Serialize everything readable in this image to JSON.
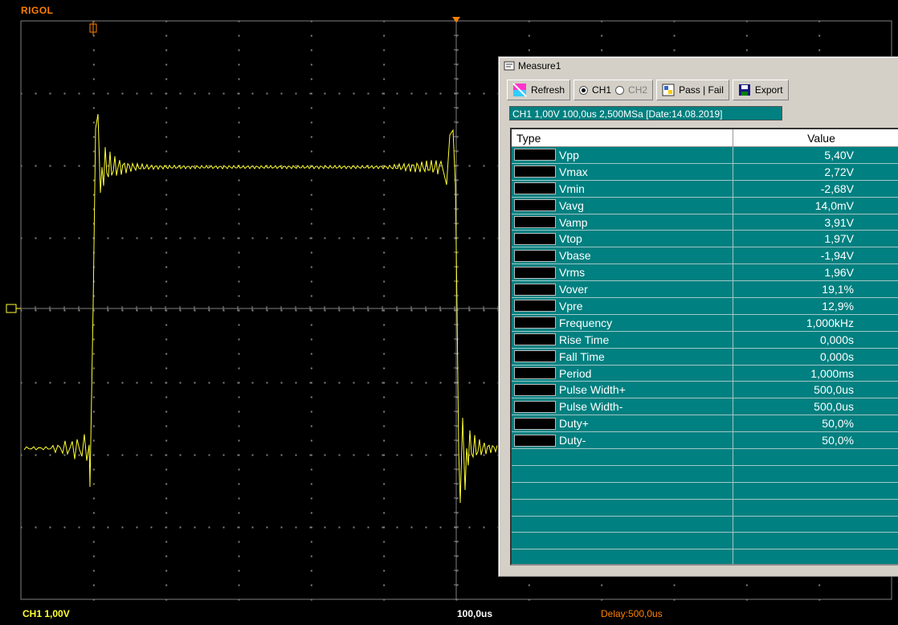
{
  "brand": "RIGOL",
  "status": {
    "channel": "CH1  1,00V",
    "timebase": "100,0us",
    "delay": "Delay:500,0us"
  },
  "window": {
    "title": "Measure1",
    "toolbar": {
      "refresh": "Refresh",
      "ch1": "CH1",
      "ch2": "CH2",
      "passfail": "Pass | Fail",
      "export": "Export"
    },
    "info": "CH1 1,00V  100,0us 2,500MSa  [Date:14.08.2019]",
    "table": {
      "col_type": "Type",
      "col_value": "Value",
      "rows": [
        {
          "type": "Vpp",
          "value": "5,40V"
        },
        {
          "type": "Vmax",
          "value": "2,72V"
        },
        {
          "type": "Vmin",
          "value": "-2,68V"
        },
        {
          "type": "Vavg",
          "value": "14,0mV"
        },
        {
          "type": "Vamp",
          "value": "3,91V"
        },
        {
          "type": "Vtop",
          "value": "1,97V"
        },
        {
          "type": "Vbase",
          "value": "-1,94V"
        },
        {
          "type": "Vrms",
          "value": "1,96V"
        },
        {
          "type": "Vover",
          "value": "19,1%"
        },
        {
          "type": "Vpre",
          "value": "12,9%"
        },
        {
          "type": "Frequency",
          "value": "1,000kHz"
        },
        {
          "type": "Rise Time",
          "value": "0,000s"
        },
        {
          "type": "Fall Time",
          "value": "0,000s"
        },
        {
          "type": "Period",
          "value": "1,000ms"
        },
        {
          "type": "Pulse Width+",
          "value": "500,0us"
        },
        {
          "type": "Pulse Width-",
          "value": "500,0us"
        },
        {
          "type": "Duty+",
          "value": "50,0%"
        },
        {
          "type": "Duty-",
          "value": "50,0%"
        }
      ]
    }
  },
  "colors": {
    "trace": "#ffff33",
    "grid": "#808080",
    "marker": "#ff8000",
    "table_bg": "#008080"
  }
}
